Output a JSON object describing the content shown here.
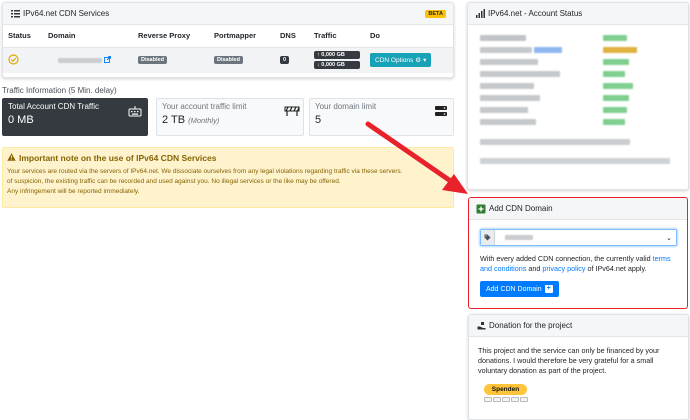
{
  "services": {
    "title": "IPv64.net CDN Services",
    "badge": "BETA",
    "columns": [
      "Status",
      "Domain",
      "Reverse Proxy",
      "Portmapper",
      "DNS",
      "Traffic",
      "Do"
    ],
    "row": {
      "reverse_proxy": "Disabled",
      "portmapper": "Disabled",
      "dns": "0",
      "traffic_up": "↑ 0,000 GB",
      "traffic_down": "↓ 0,000 GB",
      "action": "CDN Options"
    }
  },
  "traffic": {
    "title": "Traffic Information (5 Min. delay)",
    "total_label": "Total Account CDN Traffic",
    "total_value": "0 MB",
    "limit_label": "Your account traffic limit",
    "limit_value": "2 TB",
    "limit_unit": "(Monthly)",
    "domain_label": "Your domain limit",
    "domain_value": "5"
  },
  "warning": {
    "title": "Important note on the use of IPv64 CDN Services",
    "line1": "Your services are routed via the servers of IPv64.net. We dissociate ourselves from any legal violations regarding traffic via these servers.",
    "line2": "of suspicion, the existing traffic can be recorded and used against you. No illegal services or the like may be offered.",
    "line3": "Any infringement will be reported immediately."
  },
  "account": {
    "title": "IPv64.net - Account Status"
  },
  "cdn_domain": {
    "title": "Add CDN Domain",
    "text_before": "With every added CDN connection, the currently valid ",
    "link_terms": "terms and conditions",
    "text_and": " and ",
    "link_privacy": "privacy policy",
    "text_after": " of IPv64.net apply.",
    "button": "Add CDN Domain"
  },
  "donation": {
    "title": "Donation for the project",
    "text": "This project and the service can only be financed by your donations. I would therefore be very grateful for a small voluntary donation as part of the project.",
    "button": "Spenden"
  },
  "colors": {
    "accent": "#17a2b8",
    "primary": "#007bff",
    "warning_bg": "#fff3cd",
    "highlight_border": "#e8212a"
  }
}
